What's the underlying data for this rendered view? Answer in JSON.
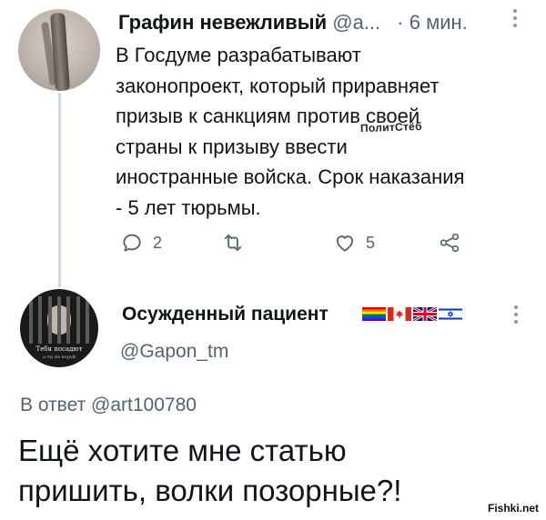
{
  "tweet1": {
    "author_name": "Графин невежливый",
    "author_handle": "@а...",
    "time": "· 6 мин.",
    "lines": [
      "В Госдуме разрабатывают",
      "законопроект, который приравняет",
      "призыв к санкциям против своей",
      "страны к призыву ввести",
      "иностранные войска. Срок наказания",
      "- 5 лет тюрьмы."
    ],
    "overlay_tag": "ПолитСтёб",
    "actions": {
      "replies": "2",
      "retweets": "",
      "likes": "5"
    },
    "icons": [
      "reply-icon",
      "retweet-icon",
      "like-icon",
      "share-icon",
      "more-icon"
    ]
  },
  "tweet2": {
    "author_name": "Осужденный пациент",
    "author_handle": "@Gapon_tm",
    "avatar_caption": [
      "Тебя посадют",
      "а ты не воруй"
    ],
    "flags": [
      "rainbow-flag",
      "canada-flag",
      "uk-flag",
      "israel-flag"
    ],
    "reply_prefix": "В ответ",
    "reply_handle": "@art100780",
    "lines": [
      "Ещё хотите мне статью",
      "пришить, волки позорные?!"
    ]
  },
  "watermark": "Fishki.net",
  "colors": {
    "text": "#0f1419",
    "secondary": "#536471",
    "thread_line": "#cfd9de"
  }
}
